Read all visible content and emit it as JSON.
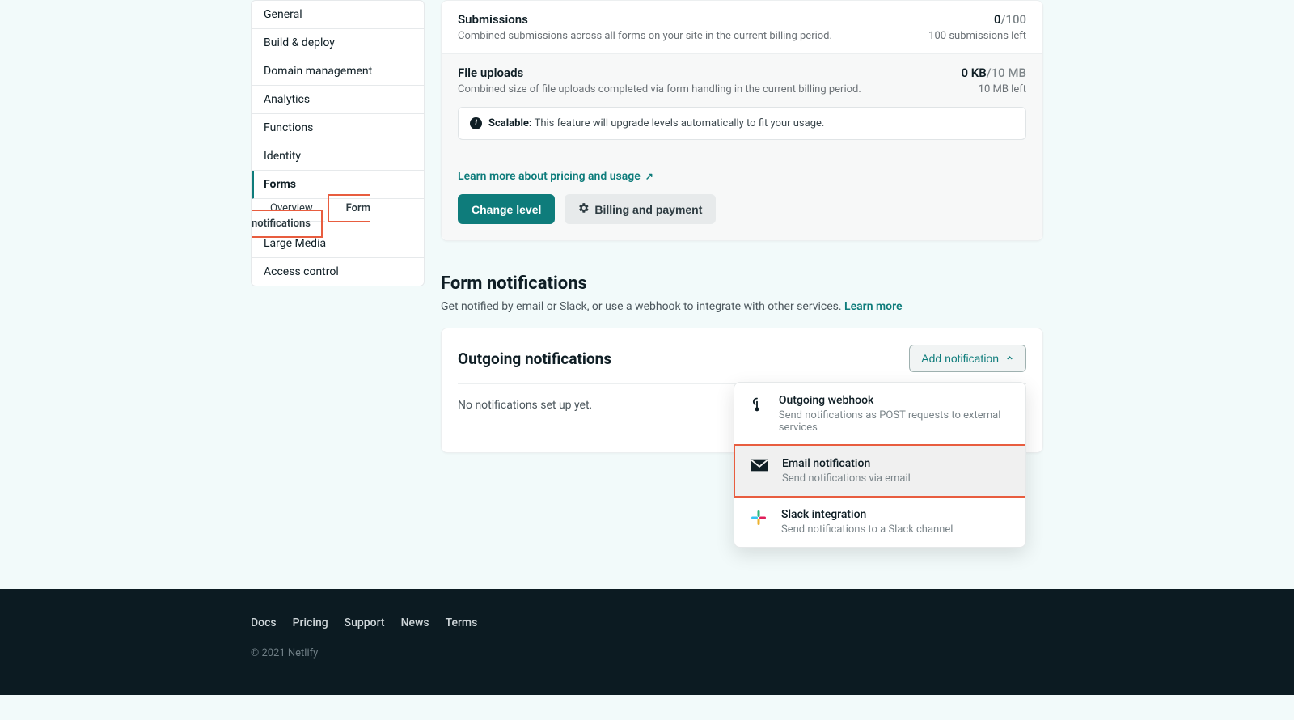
{
  "sidebar": {
    "items": [
      {
        "label": "General"
      },
      {
        "label": "Build & deploy"
      },
      {
        "label": "Domain management"
      },
      {
        "label": "Analytics"
      },
      {
        "label": "Functions"
      },
      {
        "label": "Identity"
      }
    ],
    "active": {
      "label": "Forms",
      "sub": [
        {
          "label": "Overview"
        },
        {
          "label": "Form notifications"
        }
      ]
    },
    "items_after": [
      {
        "label": "Large Media"
      },
      {
        "label": "Access control"
      }
    ]
  },
  "usage": {
    "submissions": {
      "title": "Submissions",
      "desc": "Combined submissions across all forms on your site in the current billing period.",
      "used": "0",
      "limit": "/100",
      "sub": "100 submissions left"
    },
    "uploads": {
      "title": "File uploads",
      "desc": "Combined size of file uploads completed via form handling in the current billing period.",
      "used": "0 KB",
      "limit": "/10 MB",
      "sub": "10 MB left"
    },
    "scalable": {
      "label": "Scalable:",
      "text": "This feature will upgrade levels automatically to fit your usage."
    },
    "learn_more": "Learn more about pricing and usage",
    "change_level": "Change level",
    "billing": "Billing and payment"
  },
  "notifications": {
    "heading": "Form notifications",
    "subtext": "Get notified by email or Slack, or use a webhook to integrate with other services. ",
    "learn_more": "Learn more",
    "outgoing_title": "Outgoing notifications",
    "add_button": "Add notification",
    "empty": "No notifications set up yet.",
    "dropdown": [
      {
        "title": "Outgoing webhook",
        "desc": "Send notifications as POST requests to external services"
      },
      {
        "title": "Email notification",
        "desc": "Send notifications via email"
      },
      {
        "title": "Slack integration",
        "desc": "Send notifications to a Slack channel"
      }
    ]
  },
  "footer": {
    "links": [
      "Docs",
      "Pricing",
      "Support",
      "News",
      "Terms"
    ],
    "copyright": "© 2021 Netlify"
  }
}
